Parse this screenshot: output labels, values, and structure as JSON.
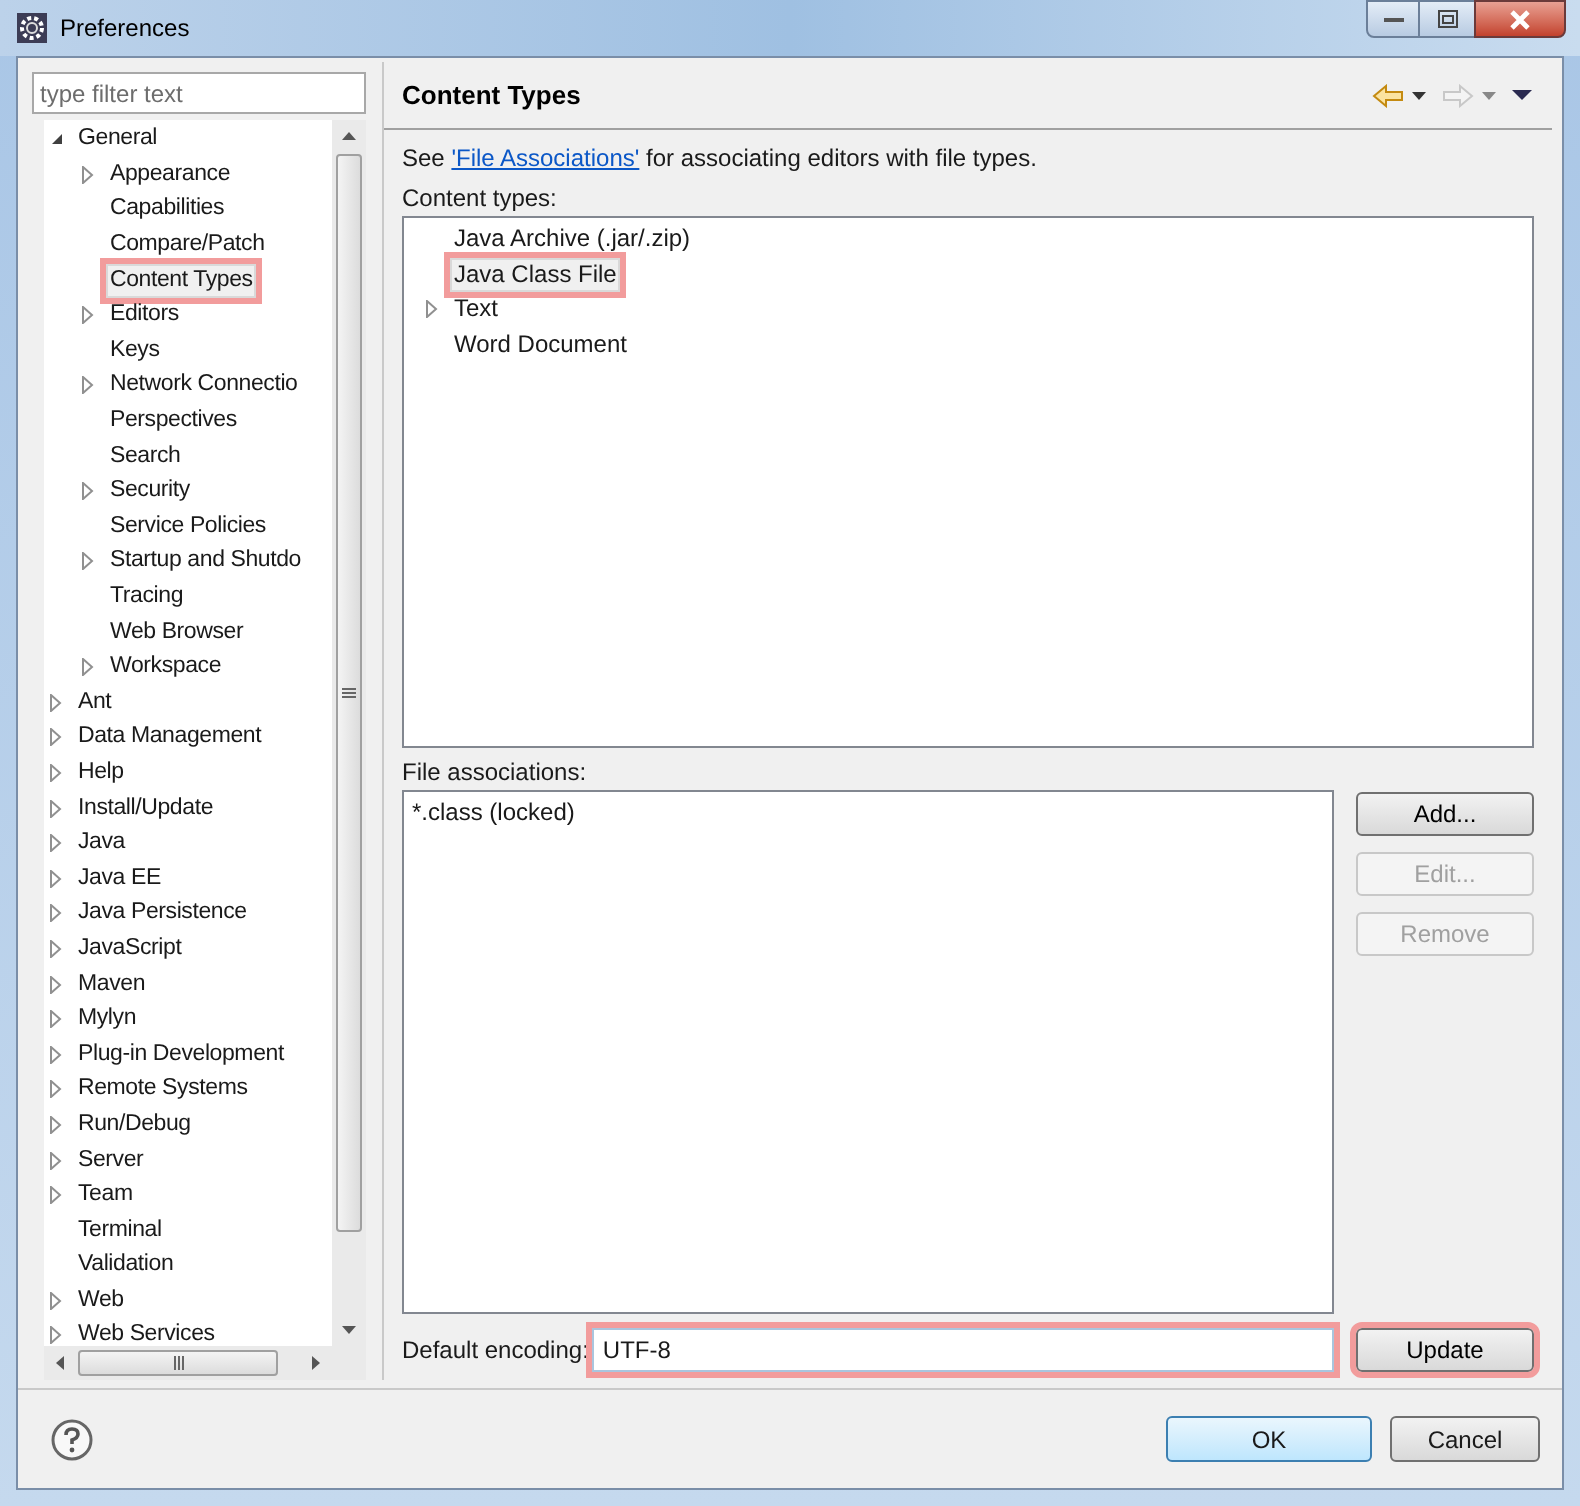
{
  "window": {
    "title": "Preferences"
  },
  "filter": {
    "placeholder": "type filter text"
  },
  "tree": [
    {
      "label": "General",
      "kind": "expanded",
      "selected": false,
      "highlighted": false,
      "children": [
        {
          "label": "Appearance",
          "kind": "collapsed",
          "selected": false,
          "highlighted": false
        },
        {
          "label": "Capabilities",
          "kind": "leaf",
          "selected": false,
          "highlighted": false
        },
        {
          "label": "Compare/Patch",
          "kind": "leaf",
          "selected": false,
          "highlighted": false
        },
        {
          "label": "Content Types",
          "kind": "leaf",
          "selected": true,
          "highlighted": true
        },
        {
          "label": "Editors",
          "kind": "collapsed",
          "selected": false,
          "highlighted": false
        },
        {
          "label": "Keys",
          "kind": "leaf",
          "selected": false,
          "highlighted": false
        },
        {
          "label": "Network Connectio",
          "kind": "collapsed",
          "selected": false,
          "highlighted": false
        },
        {
          "label": "Perspectives",
          "kind": "leaf",
          "selected": false,
          "highlighted": false
        },
        {
          "label": "Search",
          "kind": "leaf",
          "selected": false,
          "highlighted": false
        },
        {
          "label": "Security",
          "kind": "collapsed",
          "selected": false,
          "highlighted": false
        },
        {
          "label": "Service Policies",
          "kind": "leaf",
          "selected": false,
          "highlighted": false
        },
        {
          "label": "Startup and Shutdo",
          "kind": "collapsed",
          "selected": false,
          "highlighted": false
        },
        {
          "label": "Tracing",
          "kind": "leaf",
          "selected": false,
          "highlighted": false
        },
        {
          "label": "Web Browser",
          "kind": "leaf",
          "selected": false,
          "highlighted": false
        },
        {
          "label": "Workspace",
          "kind": "collapsed",
          "selected": false,
          "highlighted": false
        }
      ]
    },
    {
      "label": "Ant",
      "kind": "collapsed",
      "selected": false,
      "highlighted": false
    },
    {
      "label": "Data Management",
      "kind": "collapsed",
      "selected": false,
      "highlighted": false
    },
    {
      "label": "Help",
      "kind": "collapsed",
      "selected": false,
      "highlighted": false
    },
    {
      "label": "Install/Update",
      "kind": "collapsed",
      "selected": false,
      "highlighted": false
    },
    {
      "label": "Java",
      "kind": "collapsed",
      "selected": false,
      "highlighted": false
    },
    {
      "label": "Java EE",
      "kind": "collapsed",
      "selected": false,
      "highlighted": false
    },
    {
      "label": "Java Persistence",
      "kind": "collapsed",
      "selected": false,
      "highlighted": false
    },
    {
      "label": "JavaScript",
      "kind": "collapsed",
      "selected": false,
      "highlighted": false
    },
    {
      "label": "Maven",
      "kind": "collapsed",
      "selected": false,
      "highlighted": false
    },
    {
      "label": "Mylyn",
      "kind": "collapsed",
      "selected": false,
      "highlighted": false
    },
    {
      "label": "Plug-in Development",
      "kind": "collapsed",
      "selected": false,
      "highlighted": false
    },
    {
      "label": "Remote Systems",
      "kind": "collapsed",
      "selected": false,
      "highlighted": false
    },
    {
      "label": "Run/Debug",
      "kind": "collapsed",
      "selected": false,
      "highlighted": false
    },
    {
      "label": "Server",
      "kind": "collapsed",
      "selected": false,
      "highlighted": false
    },
    {
      "label": "Team",
      "kind": "collapsed",
      "selected": false,
      "highlighted": false
    },
    {
      "label": "Terminal",
      "kind": "leaf",
      "selected": false,
      "highlighted": false
    },
    {
      "label": "Validation",
      "kind": "leaf",
      "selected": false,
      "highlighted": false
    },
    {
      "label": "Web",
      "kind": "collapsed",
      "selected": false,
      "highlighted": false
    },
    {
      "label": "Web Services",
      "kind": "collapsed",
      "selected": false,
      "highlighted": false
    }
  ],
  "page": {
    "title": "Content Types",
    "description": {
      "prefix": "See",
      "link": "'File Associations'",
      "suffix": "for associating editors with file types."
    }
  },
  "content_types": {
    "label": "Content types:",
    "items": [
      {
        "label": "Java Archive (.jar/.zip)",
        "kind": "leaf",
        "selected": false,
        "highlighted": false
      },
      {
        "label": "Java Class File",
        "kind": "leaf",
        "selected": true,
        "highlighted": true
      },
      {
        "label": "Text",
        "kind": "collapsed",
        "selected": false,
        "highlighted": false
      },
      {
        "label": "Word Document",
        "kind": "leaf",
        "selected": false,
        "highlighted": false
      }
    ]
  },
  "file_associations": {
    "label": "File associations:",
    "items": [
      {
        "label": "*.class (locked)"
      }
    ],
    "buttons": [
      {
        "label": "Add...",
        "disabled": false
      },
      {
        "label": "Edit...",
        "disabled": true
      },
      {
        "label": "Remove",
        "disabled": true
      }
    ]
  },
  "encoding": {
    "label": "Default encoding:",
    "value": "UTF-8",
    "highlighted": true
  },
  "update_button": {
    "label": "Update",
    "highlighted": true
  },
  "footer_buttons": [
    {
      "label": "OK",
      "default": true
    },
    {
      "label": "Cancel",
      "default": false
    }
  ]
}
